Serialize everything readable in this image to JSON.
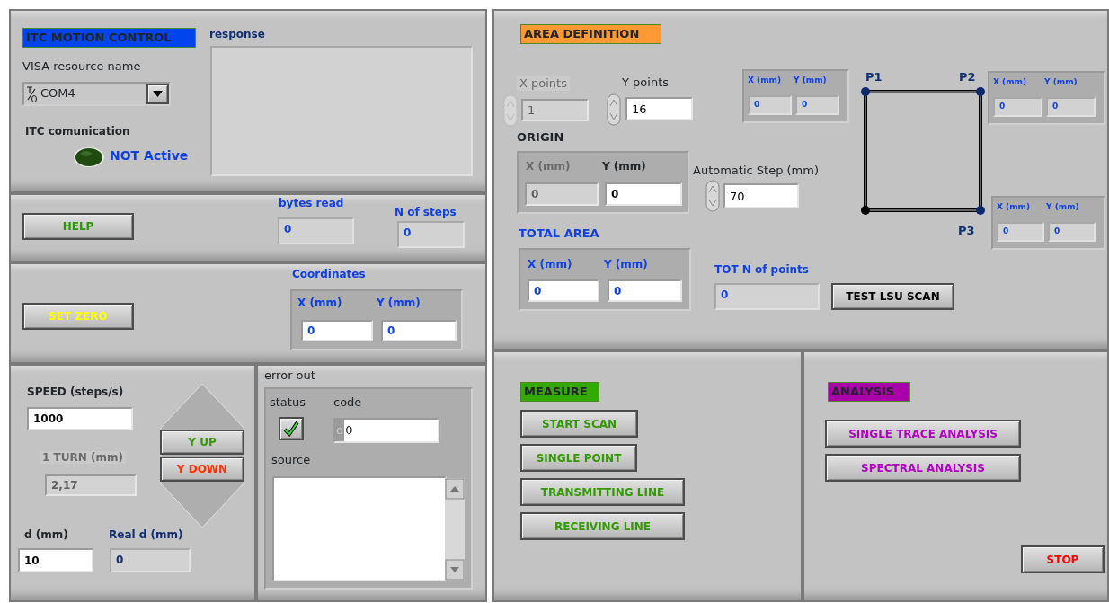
{
  "itc": {
    "title": "ITC MOTION CONTROL",
    "visa_label": "VISA resource name",
    "visa_value": "COM4",
    "comm_label": "ITC comunication",
    "comm_led_on": false,
    "comm_status": "NOT Active",
    "response_label": "response"
  },
  "help_button": "HELP",
  "bytes_read": {
    "label": "bytes read",
    "value": "0"
  },
  "n_steps": {
    "label": "N of steps",
    "value": "0"
  },
  "set_zero_button": "SET ZERO",
  "coordinates": {
    "label": "Coordinates",
    "x_label": "X (mm)",
    "x_value": "0",
    "y_label": "Y (mm)",
    "y_value": "0"
  },
  "speed": {
    "label": "SPEED (steps/s)",
    "value": "1000"
  },
  "turn": {
    "label": "1 TURN (mm)",
    "value": "2,17",
    "disabled": true
  },
  "y_up_button": "Y UP",
  "y_down_button": "Y DOWN",
  "d": {
    "label": "d (mm)",
    "value": "10"
  },
  "real_d": {
    "label": "Real d (mm)",
    "value": "0"
  },
  "error_out": {
    "label": "error out",
    "status_label": "status",
    "status_ok": true,
    "code_label": "code",
    "code_prefix": "d",
    "code_value": "0",
    "source_label": "source"
  },
  "area": {
    "title": "AREA DEFINITION",
    "x_points": {
      "label": "X points",
      "value": "1",
      "disabled": true
    },
    "y_points": {
      "label": "Y points",
      "value": "16",
      "disabled": false
    },
    "origin": {
      "label": "ORIGIN",
      "x_label": "X (mm)",
      "x_value": "0",
      "x_disabled": true,
      "y_label": "Y (mm)",
      "y_value": "0"
    },
    "step": {
      "label": "Automatic Step (mm)",
      "value": "70"
    },
    "total": {
      "label": "TOTAL AREA",
      "x_label": "X (mm)",
      "x_value": "0",
      "y_label": "Y (mm)",
      "y_value": "0"
    },
    "tot_points": {
      "label": "TOT N of points",
      "value": "0"
    },
    "test_button": "TEST LSU SCAN",
    "points": [
      {
        "label": "P1",
        "x_label": "X (mm)",
        "x_value": "0",
        "y_label": "Y (mm)",
        "y_value": "0"
      },
      {
        "label": "P2",
        "x_label": "X (mm)",
        "x_value": "0",
        "y_label": "Y (mm)",
        "y_value": "0"
      },
      {
        "label": "P3",
        "x_label": "X (mm)",
        "x_value": "0",
        "y_label": "Y (mm)",
        "y_value": "0"
      }
    ]
  },
  "measure": {
    "title": "MEASURE",
    "buttons": [
      "START SCAN",
      "SINGLE POINT",
      "TRANSMITTING LINE",
      "RECEIVING LINE"
    ]
  },
  "analysis": {
    "title": "ANALYSIS",
    "buttons": [
      "SINGLE TRACE ANALYSIS",
      "SPECTRAL ANALYSIS"
    ]
  },
  "stop_button": "STOP"
}
